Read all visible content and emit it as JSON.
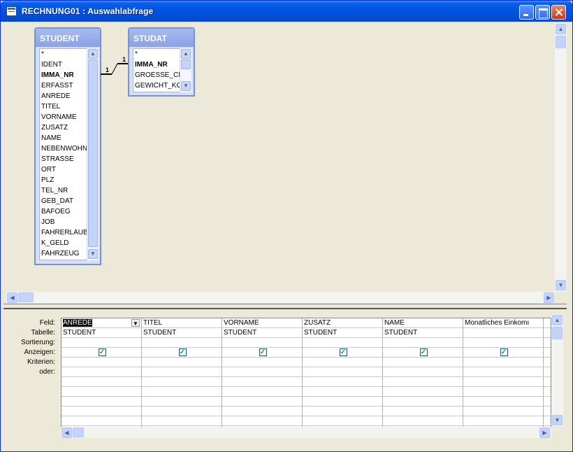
{
  "window": {
    "title": "RECHNUNG01 : Auswahlabfrage",
    "accent": "#0054e3"
  },
  "tables": [
    {
      "name": "STUDENT",
      "fields": [
        {
          "label": "*",
          "key": false
        },
        {
          "label": "IDENT",
          "key": false
        },
        {
          "label": "IMMA_NR",
          "key": true
        },
        {
          "label": "ERFASST",
          "key": false
        },
        {
          "label": "ANREDE",
          "key": false
        },
        {
          "label": "TITEL",
          "key": false
        },
        {
          "label": "VORNAME",
          "key": false
        },
        {
          "label": "ZUSATZ",
          "key": false
        },
        {
          "label": "NAME",
          "key": false
        },
        {
          "label": "NEBENWOHN",
          "key": false
        },
        {
          "label": "STRASSE",
          "key": false
        },
        {
          "label": "ORT",
          "key": false
        },
        {
          "label": "PLZ",
          "key": false
        },
        {
          "label": "TEL_NR",
          "key": false
        },
        {
          "label": "GEB_DAT",
          "key": false
        },
        {
          "label": "BAFOEG",
          "key": false
        },
        {
          "label": "JOB",
          "key": false
        },
        {
          "label": "FAHRERLAUB",
          "key": false
        },
        {
          "label": "K_GELD",
          "key": false
        },
        {
          "label": "FAHRZEUG",
          "key": false
        }
      ]
    },
    {
      "name": "STUDAT",
      "fields": [
        {
          "label": "*",
          "key": false
        },
        {
          "label": "IMMA_NR",
          "key": true
        },
        {
          "label": "GROESSE_CM",
          "key": false
        },
        {
          "label": "GEWICHT_KG",
          "key": false
        }
      ]
    }
  ],
  "relationship": {
    "left_cardinality": "1",
    "right_cardinality": "1"
  },
  "qbe": {
    "row_labels": [
      "Feld:",
      "Tabelle:",
      "Sortierung:",
      "Anzeigen:",
      "Kriterien:",
      "oder:"
    ],
    "columns": [
      {
        "field": "ANREDE",
        "table": "STUDENT",
        "sort": "",
        "show": true,
        "selected": true
      },
      {
        "field": "TITEL",
        "table": "STUDENT",
        "sort": "",
        "show": true,
        "selected": false
      },
      {
        "field": "VORNAME",
        "table": "STUDENT",
        "sort": "",
        "show": true,
        "selected": false
      },
      {
        "field": "ZUSATZ",
        "table": "STUDENT",
        "sort": "",
        "show": true,
        "selected": false
      },
      {
        "field": "NAME",
        "table": "STUDENT",
        "sort": "",
        "show": true,
        "selected": false
      },
      {
        "field": "Monatliches Einkomı",
        "table": "",
        "sort": "",
        "show": true,
        "selected": false
      }
    ],
    "empty_rows": 8
  },
  "icons": {
    "scroll_up": "▲",
    "scroll_down": "▼",
    "scroll_left": "◀",
    "scroll_right": "▶",
    "dropdown": "▼",
    "check": "✓"
  }
}
